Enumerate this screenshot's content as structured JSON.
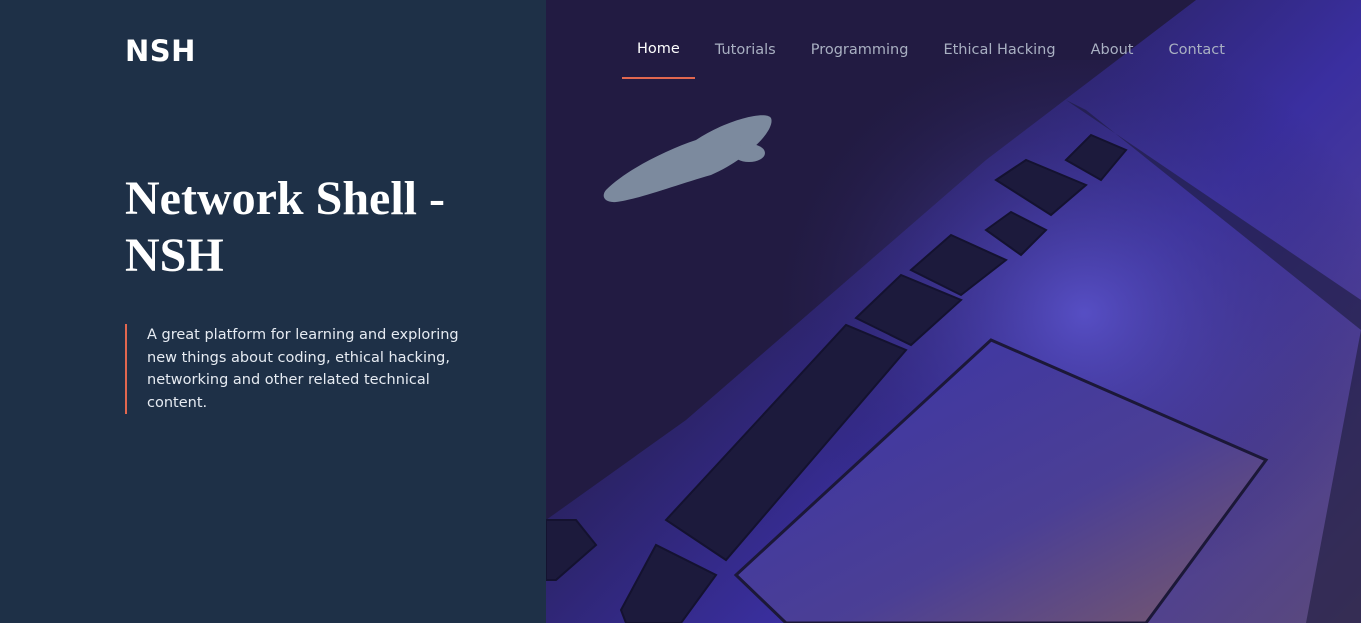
{
  "brand": {
    "logo_text": "NSH"
  },
  "nav": {
    "items": [
      {
        "label": "Home",
        "active": true
      },
      {
        "label": "Tutorials",
        "active": false
      },
      {
        "label": "Programming",
        "active": false
      },
      {
        "label": "Ethical Hacking",
        "active": false
      },
      {
        "label": "About",
        "active": false
      },
      {
        "label": "Contact",
        "active": false
      }
    ]
  },
  "hero": {
    "title_line1": "Network Shell -",
    "title_line2": "NSH",
    "description": "A great platform for learning and exploring new things about coding, ethical hacking, networking and other related technical content."
  },
  "colors": {
    "left_bg": "#1e3047",
    "accent": "#e2674f",
    "nav_active": "#ffffff",
    "nav_inactive": "#a9b0c2"
  },
  "image": {
    "subject": "laptop-keyboard-photo"
  }
}
